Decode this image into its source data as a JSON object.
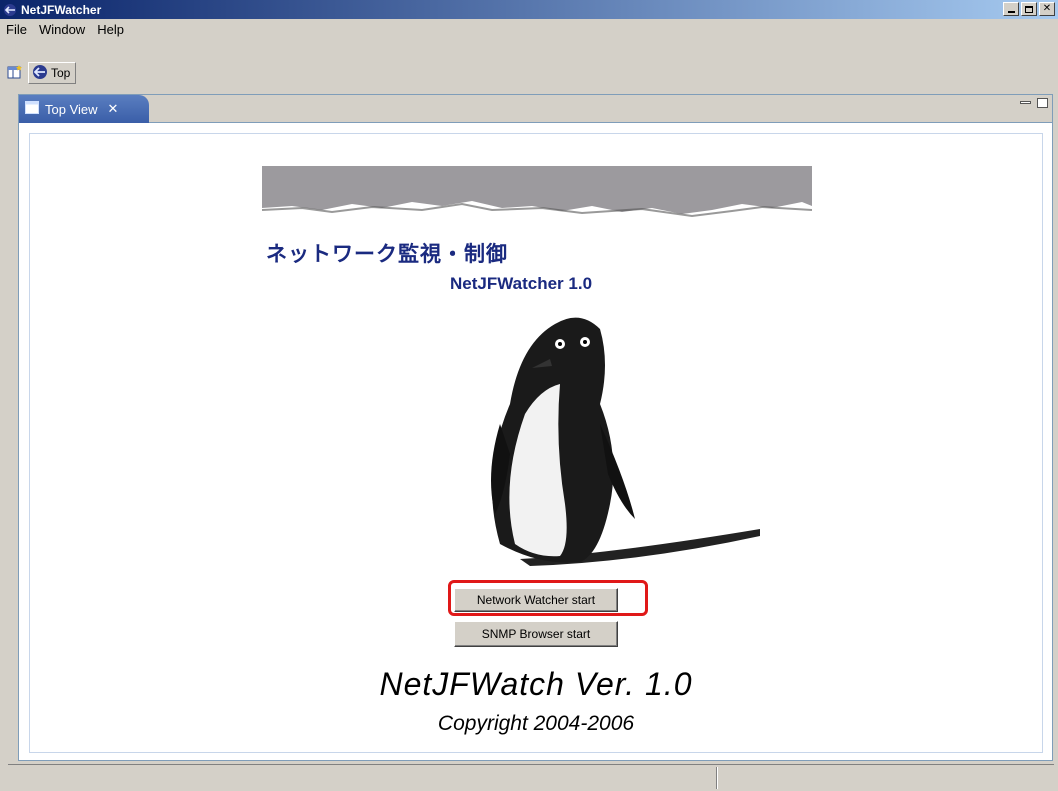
{
  "window": {
    "title": "NetJFWatcher"
  },
  "menu": {
    "items": [
      "File",
      "Window",
      "Help"
    ]
  },
  "toolbar": {
    "perspective_label": "Top"
  },
  "view": {
    "tab_label": "Top View"
  },
  "content": {
    "jp_title": "ネットワーク監視・制御",
    "app_name": "NetJFWatcher 1.0",
    "network_button": "Network Watcher start",
    "snmp_button": "SNMP Browser start",
    "footer_title": "NetJFWatch Ver. 1.0",
    "footer_copyright": "Copyright 2004-2006"
  },
  "colors": {
    "title_text": "#1a2a80",
    "highlight": "#e01818"
  }
}
